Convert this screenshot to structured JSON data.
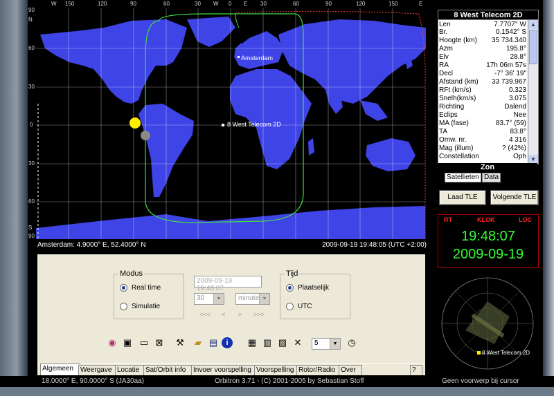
{
  "map": {
    "lon_ticks": [
      "W",
      "150",
      "120",
      "90",
      "60",
      "30",
      "W",
      "0",
      "E",
      "30",
      "60",
      "90",
      "120",
      "150",
      "E"
    ],
    "lat_ticks": [
      "90",
      "60",
      "30",
      "0",
      "30",
      "60",
      "90"
    ],
    "lat_hemis": [
      "N",
      "",
      "",
      "",
      "",
      "",
      "S"
    ],
    "city_label": "Amsterdam",
    "sat_label": "8 West Telecom 2D",
    "status_left": "Amsterdam: 4.9000° E, 52.4000° N",
    "status_right": "2009-09-19 19:48:05 (UTC +2:00)"
  },
  "panel": {
    "modus_title": "Modus",
    "modus_options": [
      "Real time",
      "Simulatie"
    ],
    "datetime_value": "2009-09-19 19:48:07",
    "step_value": "30",
    "unit_value": "minuten",
    "nav_buttons": [
      "<<<",
      "<",
      ">",
      ">>>"
    ],
    "tijd_title": "Tijd",
    "tijd_options": [
      "Plaatselijk",
      "UTC"
    ],
    "speed_value": "5"
  },
  "tabs": [
    "Algemeen",
    "Weergave",
    "Locatie",
    "Sat/Orbit info",
    "Invoer voorspelling",
    "Voorspelling",
    "Rotor/Radio",
    "Over",
    "?"
  ],
  "status": {
    "left": "18.0000° E, 90.0000° S (JA30aa)",
    "center": "Orbitron 3.71 - (C) 2001-2005 by Sebastian Stoff",
    "right": "Geen voorwerp bij cursor"
  },
  "satellite": {
    "name": "8 West Telecom 2D",
    "rows": [
      {
        "k": "Len",
        "v": "7.7707° W"
      },
      {
        "k": "Br.",
        "v": "0.1542° S"
      },
      {
        "k": "Hoogte (km)",
        "v": "35 734.340"
      },
      {
        "k": "Azm",
        "v": "195.8°"
      },
      {
        "k": "Elv",
        "v": "28.8°"
      },
      {
        "k": "RA",
        "v": "17h 06m 57s"
      },
      {
        "k": "Decl",
        "v": "-7° 36' 19\""
      },
      {
        "k": "Afstand (km)",
        "v": "33 739.967"
      },
      {
        "k": "RFt (km/s)",
        "v": "0.323"
      },
      {
        "k": "Snelh(km/s)",
        "v": "3.075"
      },
      {
        "k": "Richting",
        "v": "Dalend"
      },
      {
        "k": "Eclips",
        "v": "Nee"
      },
      {
        "k": "MA (fase)",
        "v": "83.7° (59)"
      },
      {
        "k": "TA",
        "v": "83.8°"
      },
      {
        "k": "Omw. nr.",
        "v": "4 316"
      },
      {
        "k": "Mag (illum)",
        "v": "? (42%)"
      },
      {
        "k": "Constellation",
        "v": "Oph"
      }
    ],
    "section": "Zon",
    "subtabs": [
      "Satellieten",
      "Data"
    ],
    "load_tle": "Laad TLE",
    "next_tle": "Volgende TLE"
  },
  "clock": {
    "labels": [
      "RT",
      "KLOK",
      "LOC"
    ],
    "time": "19:48:07",
    "date": "2009-09-19"
  },
  "radar": {
    "sat_label": "8 West Telecom 2D"
  },
  "colors": {
    "ocean": "#000000",
    "land": "#3f44e6",
    "grid": "#ffffff",
    "footprint": "#40e040",
    "clock_text": "#33ff33",
    "clock_label": "#ff2020"
  }
}
